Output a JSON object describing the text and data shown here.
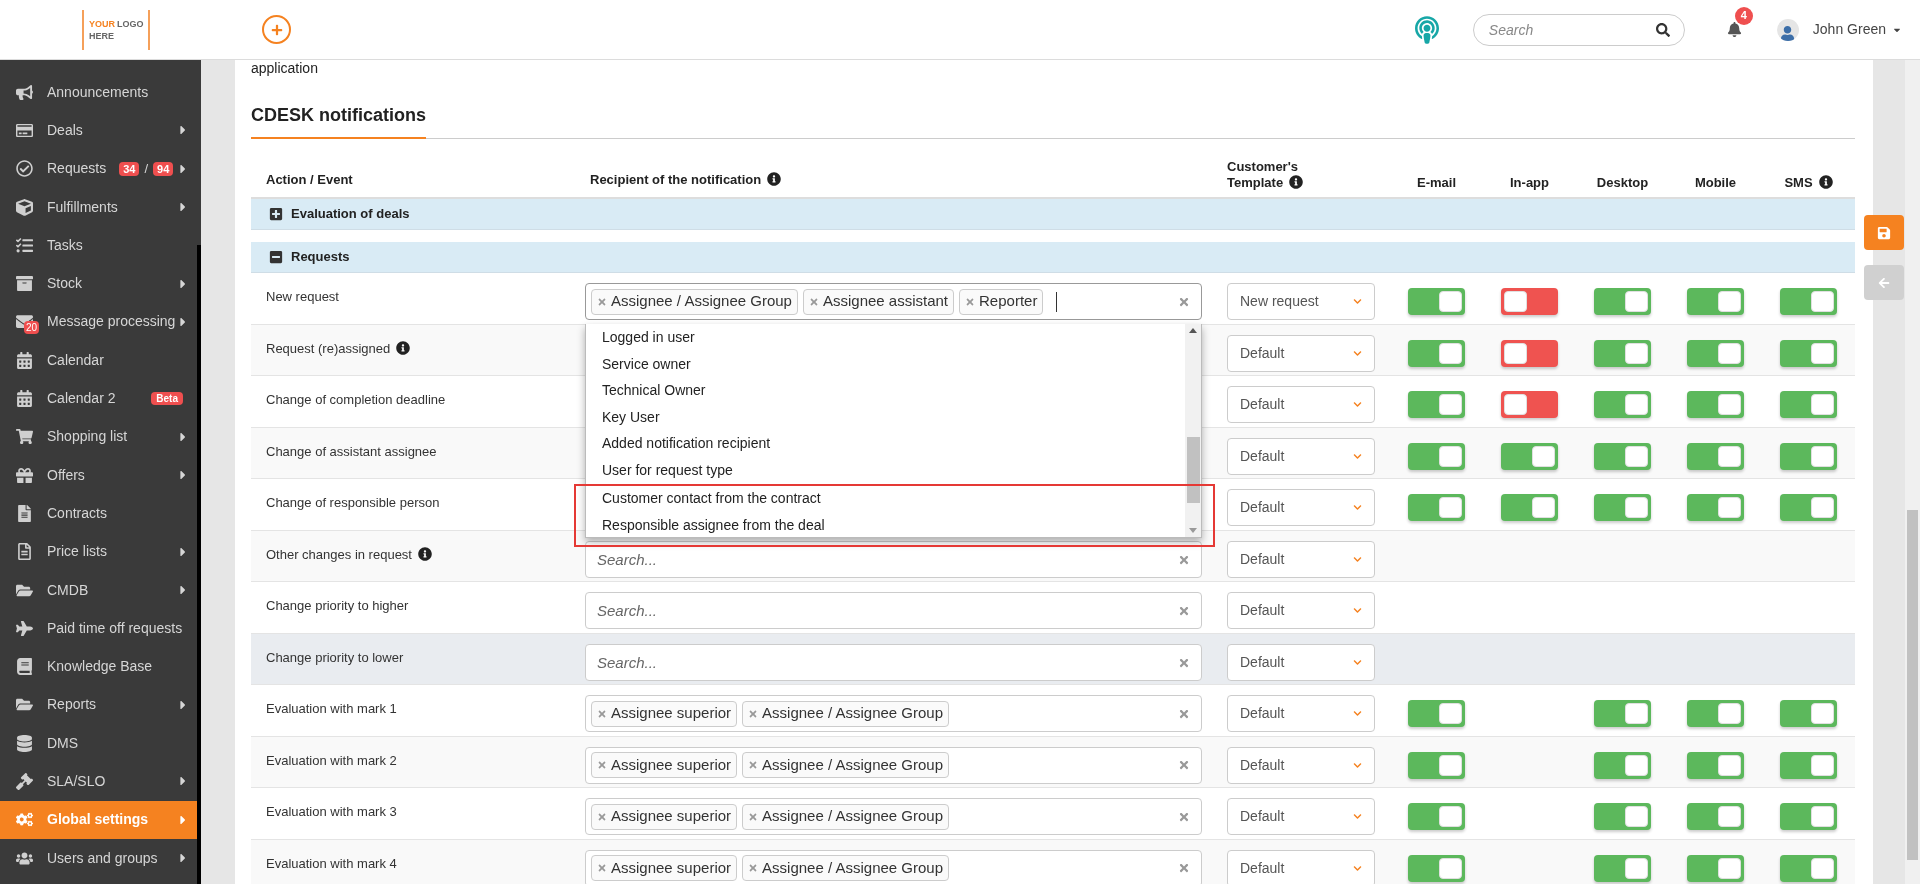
{
  "topbar": {
    "logo": {
      "accent": "YOUR",
      "rest": "LOGO",
      "second": "HERE"
    },
    "search": {
      "placeholder": "Search"
    },
    "notifications": "4",
    "user": "John Green"
  },
  "sidebar": {
    "items": [
      {
        "label": "Announcements",
        "submenu": false,
        "selected": false
      },
      {
        "label": "Deals",
        "submenu": true,
        "selected": false
      },
      {
        "label": "Requests",
        "submenu": true,
        "selected": false,
        "counts": [
          "34",
          "94"
        ],
        "count_separator": "/"
      },
      {
        "label": "Fulfillments",
        "submenu": true,
        "selected": false
      },
      {
        "label": "Tasks",
        "submenu": false,
        "selected": false
      },
      {
        "label": "Stock",
        "submenu": true,
        "selected": false
      },
      {
        "label": "Message processing",
        "submenu": true,
        "selected": false,
        "icon_badge": "20"
      },
      {
        "label": "Calendar",
        "submenu": false,
        "selected": false
      },
      {
        "label": "Calendar 2",
        "submenu": false,
        "selected": false,
        "tag": "Beta"
      },
      {
        "label": "Shopping list",
        "submenu": true,
        "selected": false
      },
      {
        "label": "Offers",
        "submenu": true,
        "selected": false
      },
      {
        "label": "Contracts",
        "submenu": false,
        "selected": false
      },
      {
        "label": "Price lists",
        "submenu": true,
        "selected": false
      },
      {
        "label": "CMDB",
        "submenu": true,
        "selected": false
      },
      {
        "label": "Paid time off requests",
        "submenu": false,
        "selected": false
      },
      {
        "label": "Knowledge Base",
        "submenu": false,
        "selected": false
      },
      {
        "label": "Reports",
        "submenu": true,
        "selected": false
      },
      {
        "label": "DMS",
        "submenu": false,
        "selected": false
      },
      {
        "label": "SLA/SLO",
        "submenu": true,
        "selected": false
      },
      {
        "label": "Global settings",
        "submenu": true,
        "selected": true
      },
      {
        "label": "Users and groups",
        "submenu": true,
        "selected": false
      }
    ]
  },
  "content": {
    "intro": "application",
    "title": "CDESK notifications"
  },
  "table": {
    "columns": [
      {
        "label": "Action / Event",
        "info": false
      },
      {
        "label": "Recipient of the notification",
        "info": true
      },
      {
        "label": "Customer's Template",
        "info": true
      },
      {
        "label": "E-mail",
        "info": false
      },
      {
        "label": "In-app",
        "info": false
      },
      {
        "label": "Desktop",
        "info": false
      },
      {
        "label": "Mobile",
        "info": false
      },
      {
        "label": "SMS",
        "info": true
      }
    ],
    "groups": [
      {
        "title": "Evaluation of deals",
        "expanded": false
      },
      {
        "title": "Requests",
        "expanded": true,
        "rows": [
          {
            "event": "New request",
            "info": false,
            "hovered": false,
            "recipient": {
              "tags": [
                "Assignee / Assignee Group",
                "Assignee assistant",
                "Reporter"
              ],
              "focused": true
            },
            "template": "New request",
            "toggles": {
              "email": true,
              "in_app": false,
              "desktop": true,
              "mobile": true,
              "sms": true
            }
          },
          {
            "event": "Request (re)assigned",
            "info": true,
            "hovered": false,
            "template": "Default",
            "toggles": {
              "email": true,
              "in_app": false,
              "desktop": true,
              "mobile": true,
              "sms": true
            }
          },
          {
            "event": "Change of completion deadline",
            "info": false,
            "hovered": false,
            "template": "Default",
            "toggles": {
              "email": true,
              "in_app": false,
              "desktop": true,
              "mobile": true,
              "sms": true
            }
          },
          {
            "event": "Change of assistant assignee",
            "info": false,
            "hovered": false,
            "template": "Default",
            "toggles": {
              "email": true,
              "in_app": true,
              "desktop": true,
              "mobile": true,
              "sms": true
            }
          },
          {
            "event": "Change of responsible person",
            "info": false,
            "hovered": false,
            "template": "Default",
            "toggles": {
              "email": true,
              "in_app": true,
              "desktop": true,
              "mobile": true,
              "sms": true
            }
          },
          {
            "event": "Other changes in request",
            "info": true,
            "hovered": false,
            "recipient": {
              "placeholder": "Search...",
              "focused": false
            },
            "template": "Default"
          },
          {
            "event": "Change priority to higher",
            "info": false,
            "hovered": false,
            "recipient": {
              "placeholder": "Search...",
              "focused": false
            },
            "template": "Default"
          },
          {
            "event": "Change priority to lower",
            "info": false,
            "hovered": true,
            "recipient": {
              "placeholder": "Search...",
              "focused": false
            },
            "template": "Default"
          },
          {
            "event": "Evaluation with mark 1",
            "info": false,
            "hovered": false,
            "recipient": {
              "tags": [
                "Assignee superior",
                "Assignee / Assignee Group"
              ],
              "focused": false
            },
            "template": "Default",
            "toggles": {
              "email": true,
              "desktop": true,
              "mobile": true,
              "sms": true
            }
          },
          {
            "event": "Evaluation with mark 2",
            "info": false,
            "hovered": false,
            "recipient": {
              "tags": [
                "Assignee superior",
                "Assignee / Assignee Group"
              ],
              "focused": false
            },
            "template": "Default",
            "toggles": {
              "email": true,
              "desktop": true,
              "mobile": true,
              "sms": true
            }
          },
          {
            "event": "Evaluation with mark 3",
            "info": false,
            "hovered": false,
            "recipient": {
              "tags": [
                "Assignee superior",
                "Assignee / Assignee Group"
              ],
              "focused": false
            },
            "template": "Default",
            "toggles": {
              "email": true,
              "desktop": true,
              "mobile": true,
              "sms": true
            }
          },
          {
            "event": "Evaluation with mark 4",
            "info": false,
            "hovered": false,
            "recipient": {
              "tags": [
                "Assignee superior",
                "Assignee / Assignee Group"
              ],
              "focused": false
            },
            "template": "Default",
            "toggles": {
              "email": true,
              "desktop": true,
              "mobile": true,
              "sms": true
            }
          }
        ]
      }
    ]
  },
  "dropdown": {
    "options": [
      {
        "label": "Logged in user",
        "annotated": false
      },
      {
        "label": "Service owner",
        "annotated": false
      },
      {
        "label": "Technical Owner",
        "annotated": false
      },
      {
        "label": "Key User",
        "annotated": false
      },
      {
        "label": "Added notification recipient",
        "annotated": false
      },
      {
        "label": "User for request type",
        "annotated": false
      },
      {
        "label": "Customer contact from the contract",
        "annotated": true
      },
      {
        "label": "Responsible assignee from the deal",
        "annotated": true
      }
    ]
  }
}
